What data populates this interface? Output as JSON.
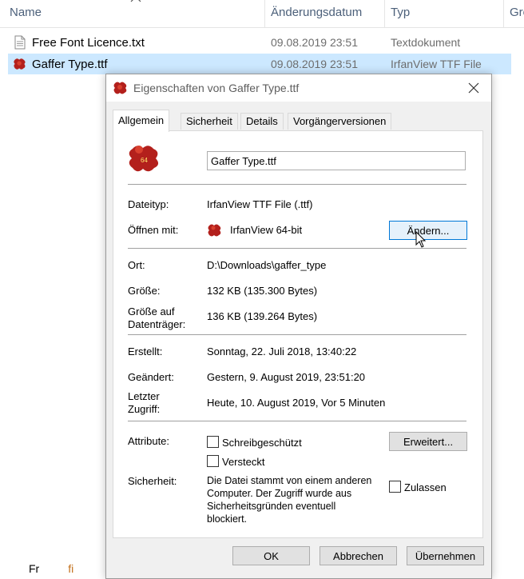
{
  "explorer": {
    "columns": {
      "name": "Name",
      "modified": "Änderungsdatum",
      "type": "Typ",
      "size": "Grö"
    },
    "rows": [
      {
        "name": "Free Font Licence.txt",
        "date": "09.08.2019 23:51",
        "type": "Textdokument",
        "icon": "text-file-icon"
      },
      {
        "name": "Gaffer Type.ttf",
        "date": "09.08.2019 23:51",
        "type": "IrfanView TTF File",
        "icon": "irfanview-icon"
      }
    ],
    "bottom_partial": {
      "a": "Fr",
      "b": "fi"
    }
  },
  "dialog": {
    "title": "Eigenschaften von Gaffer Type.ttf",
    "tabs": [
      "Allgemein",
      "Sicherheit",
      "Details",
      "Vorgängerversionen"
    ],
    "file_name_value": "Gaffer Type.ttf",
    "file_type_label": "Dateityp:",
    "file_type_value": "IrfanView TTF File (.ttf)",
    "open_with_label": "Öffnen mit:",
    "open_with_value": "IrfanView 64-bit",
    "change_button": "Ändern...",
    "location_label": "Ort:",
    "location_value": "D:\\Downloads\\gaffer_type",
    "size_label": "Größe:",
    "size_value": "132 KB (135.300 Bytes)",
    "size_on_disk_label_1": "Größe auf",
    "size_on_disk_label_2": "Datenträger:",
    "size_on_disk_value": "136 KB (139.264 Bytes)",
    "created_label": "Erstellt:",
    "created_value": "Sonntag, 22. Juli 2018, 13:40:22",
    "modified_label": "Geändert:",
    "modified_value": "Gestern, 9. August 2019, 23:51:20",
    "accessed_label_1": "Letzter",
    "accessed_label_2": "Zugriff:",
    "accessed_value": "Heute, 10. August 2019, Vor 5 Minuten",
    "attributes_label": "Attribute:",
    "readonly_label": "Schreibgeschützt",
    "hidden_label": "Versteckt",
    "advanced_button": "Erweitert...",
    "security_label": "Sicherheit:",
    "security_lines": [
      "Die Datei stammt von einem anderen",
      "Computer. Der Zugriff wurde aus",
      "Sicherheitsgründen eventuell",
      "blockiert."
    ],
    "unblock_label": "Zulassen",
    "ok_button": "OK",
    "cancel_button": "Abbrechen",
    "apply_button": "Übernehmen"
  },
  "colors": {
    "selection": "#cce8ff",
    "accent": "#0078d7",
    "icon_red": "#b3201c"
  }
}
